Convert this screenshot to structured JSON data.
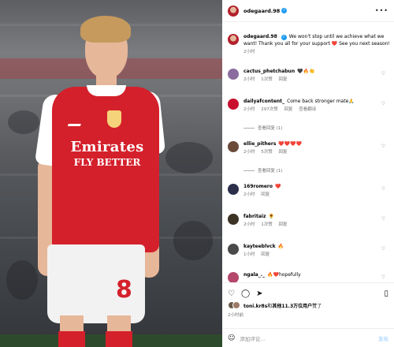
{
  "post": {
    "author": "odegaard.98",
    "author_verified_mark": "✓",
    "more_icon": "•••",
    "caption": "We won't stop until we achieve what we want! Thank you all for your support ❤️ See you next season!",
    "caption_time": "2小时",
    "photo": {
      "description_icon": "player-photo",
      "sponsor_line1": "Emirates",
      "sponsor_line2": "FLY BETTER",
      "shirt_number": "8"
    }
  },
  "comments": [
    {
      "user": "cactus_phetchabun",
      "text": "🖤🔥👏",
      "time": "2小时",
      "likes": "1次赞",
      "reply": "回复",
      "translate": "",
      "avatar_color": "#8a6d9e"
    },
    {
      "user": "dailyafcontent_",
      "text": "Come back stronger mate🙏",
      "time": "2小时",
      "likes": "297次赞",
      "reply": "回复",
      "translate": "查看翻译",
      "avatar_color": "#c8102e",
      "view_replies": "查看回复 (1)"
    },
    {
      "user": "ellie_pithers",
      "text": "❤️❤️❤️❤️",
      "time": "2小时",
      "likes": "5次赞",
      "reply": "回复",
      "translate": "",
      "avatar_color": "#6b4a3a",
      "view_replies": "查看回复 (1)"
    },
    {
      "user": "169romero",
      "text": "❤️",
      "time": "2小时",
      "likes": "",
      "reply": "回复",
      "translate": "",
      "avatar_color": "#2b2f4a"
    },
    {
      "user": "fabritaiz",
      "text": "🌻",
      "time": "2小时",
      "likes": "1次赞",
      "reply": "回复",
      "translate": "",
      "avatar_color": "#3c3325"
    },
    {
      "user": "kayteeblvck",
      "text": "🔥",
      "time": "1小时",
      "likes": "",
      "reply": "回复",
      "translate": "",
      "avatar_color": "#4a4a4a"
    },
    {
      "user": "ngala_._",
      "text": "🔥❤️hopefully",
      "time": "",
      "likes": "",
      "reply": "",
      "translate": "",
      "avatar_color": "#b4476a"
    }
  ],
  "actions": {
    "like_icon": "♡",
    "comment_icon": "◯",
    "share_icon": "➤",
    "bookmark_icon": "▯",
    "likes_prefix": "toni.kr8s",
    "likes_and": "和",
    "likes_others": "其他11.3万位用户",
    "likes_suffix": "赞了",
    "post_time": "2小时前"
  },
  "add_comment": {
    "emoji_icon": "☺",
    "placeholder": "添加评论...",
    "post_label": "发布"
  },
  "colors": {
    "accent_blue": "#1d9bf0",
    "arsenal_red": "#d4202b",
    "muted": "#737373"
  }
}
